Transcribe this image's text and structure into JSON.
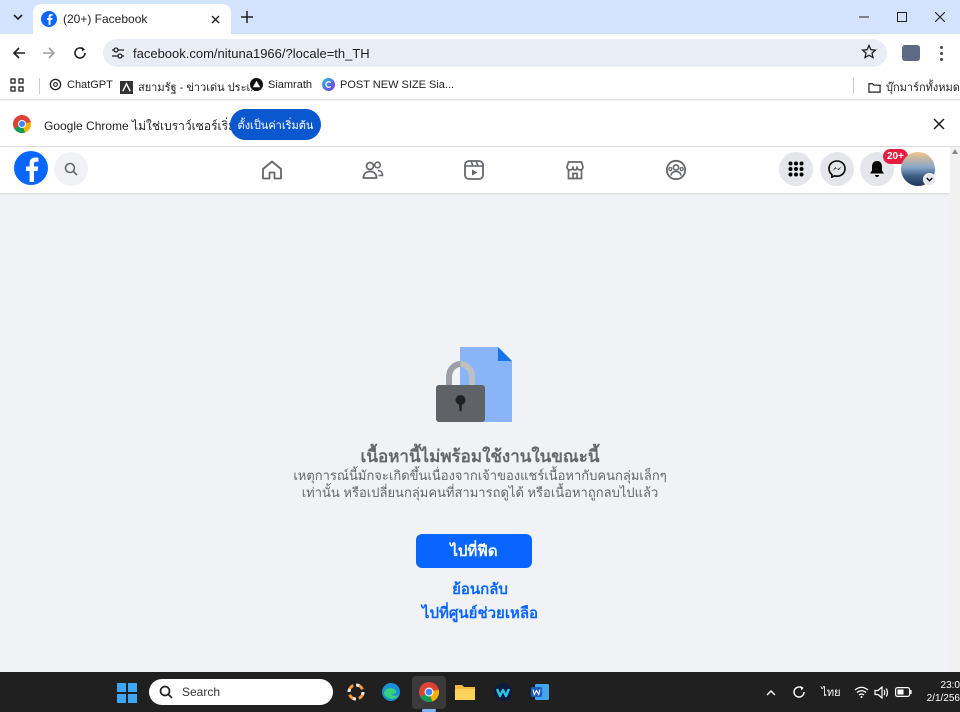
{
  "browser": {
    "tab_title": "(20+) Facebook",
    "url": "facebook.com/nituna1966/?locale=th_TH",
    "bookmarks": [
      {
        "label": "ChatGPT",
        "icon": "chatgpt-icon"
      },
      {
        "label": "สยามรัฐ - ข่าวเด่น ประเ...",
        "icon": "siamrath-icon"
      },
      {
        "label": "Siamrath",
        "icon": "siamrath-triangle-icon"
      },
      {
        "label": "POST NEW SIZE Sia...",
        "icon": "canva-icon"
      }
    ],
    "all_bookmarks_label": "บุ๊กมาร์กทั้งหมด",
    "infobar_message": "Google Chrome ไม่ใช่เบราว์เซอร์เริ่มต้น",
    "infobar_button": "ตั้งเป็นค่าเริ่มต้น"
  },
  "facebook": {
    "notification_badge": "20+",
    "nav_items": [
      "home-icon",
      "friends-icon",
      "watch-icon",
      "marketplace-icon",
      "groups-icon"
    ]
  },
  "main": {
    "heading": "เนื้อหานี้ไม่พร้อมใช้งานในขณะนี้",
    "description": "เหตุการณ์นี้มักจะเกิดขึ้นเนื่องจากเจ้าของแชร์เนื้อหากับคนกลุ่มเล็กๆ เท่านั้น หรือเปลี่ยนกลุ่มคนที่สามารถดูได้ หรือเนื้อหาถูกลบไปแล้ว",
    "primary_button": "ไปที่ฟีด",
    "back_link": "ย้อนกลับ",
    "help_link": "ไปที่ศูนย์ช่วยเหลือ"
  },
  "taskbar": {
    "search_placeholder": "Search",
    "language": "ไทย",
    "time": "23:0",
    "date": "2/1/256"
  },
  "colors": {
    "facebook_blue": "#0866ff",
    "chrome_tabstrip": "#d3e3fd",
    "chrome_button": "#0b57d0",
    "badge_red": "#e41e3f",
    "page_bg": "#f0f2f5"
  }
}
